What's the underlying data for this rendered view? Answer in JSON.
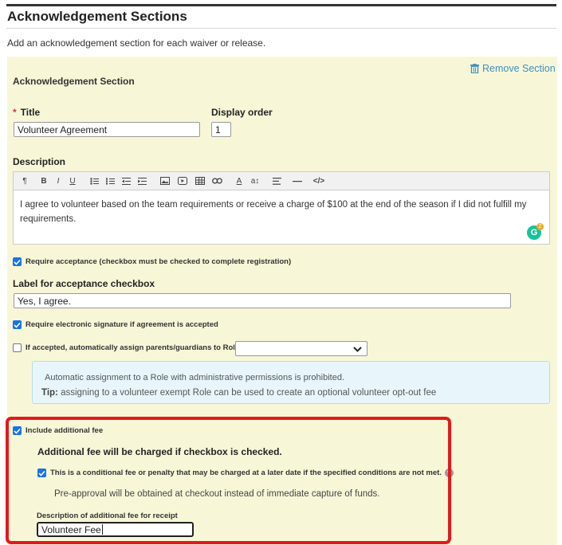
{
  "header": {
    "title": "Acknowledgement Sections",
    "intro": "Add an acknowledgement section for each waiver or release."
  },
  "section": {
    "title": "Acknowledgement Section",
    "remove_label": "Remove Section",
    "title_label": "Title",
    "title_required_mark": "*",
    "title_value": "Volunteer Agreement",
    "display_order_label": "Display order",
    "display_order_value": "1",
    "description_label": "Description",
    "description_text": "I agree to volunteer based on the team requirements or receive a charge of $100 at the end of the season if I did not fulfill my requirements.",
    "grammarly_letter": "G",
    "grammarly_count": "2",
    "toolbar_icons": [
      "paragraph-icon",
      "bold-icon",
      "italic-icon",
      "underline-icon",
      "bullet-list-icon",
      "numbered-list-icon",
      "outdent-icon",
      "indent-icon",
      "image-icon",
      "video-icon",
      "table-icon",
      "link-icon",
      "font-color-icon",
      "font-size-icon",
      "align-icon",
      "horizontal-rule-icon",
      "code-view-icon"
    ],
    "toolbar_text": {
      "paragraph": "¶",
      "bold": "B",
      "italic": "I",
      "underline": "U",
      "font_color": "A",
      "font_size": "a↕",
      "code": "</>"
    }
  },
  "acceptance": {
    "require_label": "Require acceptance (checkbox must be checked to complete registration)",
    "require_checked": true,
    "checkbox_label_heading": "Label for acceptance checkbox",
    "checkbox_label_value": "Yes, I agree.",
    "esign_label": "Require electronic signature if agreement is accepted",
    "esign_checked": true,
    "assign_role_label": "If accepted, automatically assign parents/guardians to Role:",
    "assign_role_checked": false,
    "role_value": ""
  },
  "info": {
    "line1": "Automatic assignment to a Role with administrative permissions is prohibited.",
    "tip_prefix": "Tip:",
    "tip_text": "assigning to a volunteer exempt Role can be used to create an optional volunteer opt-out fee"
  },
  "fee": {
    "include_label": "Include additional fee",
    "include_checked": true,
    "charged_notice": "Additional fee will be charged if checkbox is checked.",
    "conditional_label": "This is a conditional fee or penalty that may be charged at a later date if the specified conditions are not met.",
    "conditional_checked": true,
    "help_mark": "?",
    "preapproval_text": "Pre-approval will be obtained at checkout instead of immediate capture of funds.",
    "description_label": "Description of additional fee for receipt",
    "description_value": "Volunteer Fee"
  },
  "colors": {
    "accent": "#1a73e8",
    "link": "#3f8fc4",
    "panel": "#f7f7d8",
    "highlight": "#e3191c",
    "info_bg": "#e8f6fb"
  }
}
